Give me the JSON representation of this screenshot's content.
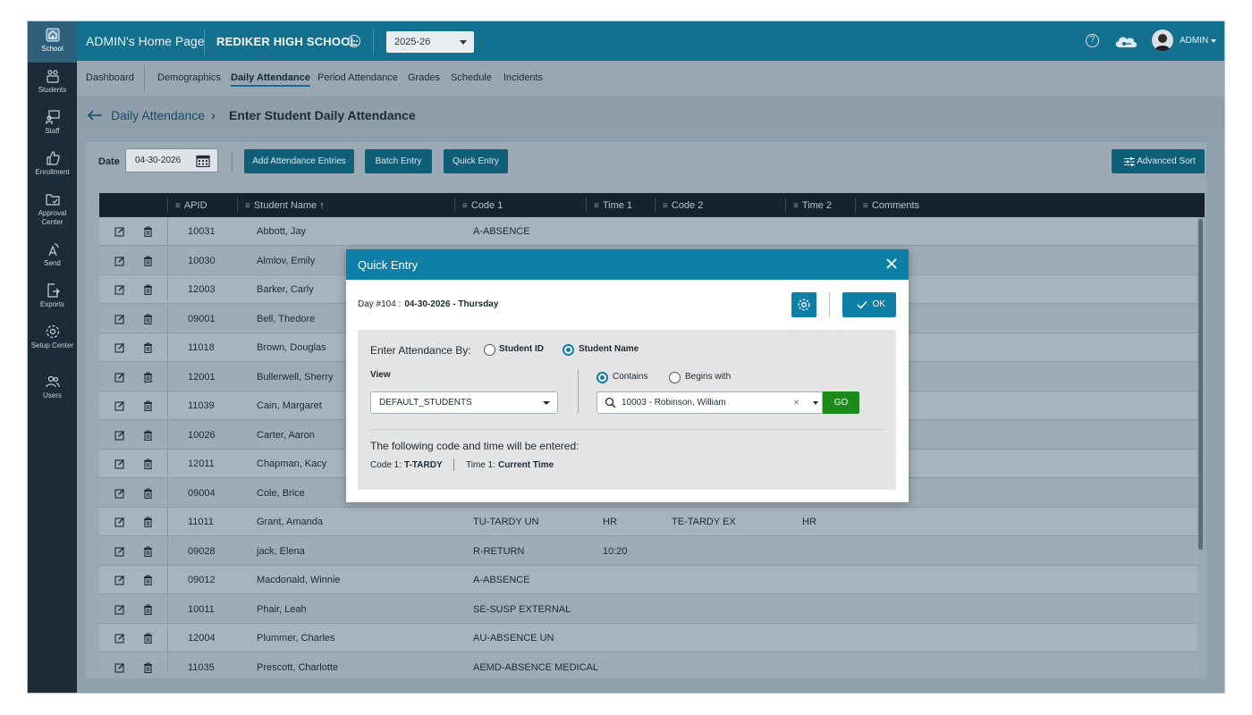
{
  "sidebar": {
    "items": [
      {
        "label": "School",
        "icon": "school-icon",
        "active": true
      },
      {
        "label": "Students",
        "icon": "students-icon"
      },
      {
        "label": "Staff",
        "icon": "staff-icon"
      },
      {
        "label": "Enrollment",
        "icon": "thumbs-up-icon"
      },
      {
        "label": "Approval Center",
        "icon": "folder-check-icon"
      },
      {
        "label": "Send",
        "icon": "send-icon"
      },
      {
        "label": "Exports",
        "icon": "export-icon"
      },
      {
        "label": "Setup Center",
        "icon": "gear-icon"
      },
      {
        "label": "Users",
        "icon": "users-icon"
      }
    ]
  },
  "header": {
    "home_title": "ADMIN's Home Page",
    "school": "REDIKER HIGH SCHOOL",
    "year": "2025-26",
    "user": "ADMIN"
  },
  "subnav": {
    "tabs": [
      "Dashboard",
      "Demographics",
      "Daily Attendance",
      "Period Attendance",
      "Grades",
      "Schedule",
      "Incidents"
    ],
    "active": "Daily Attendance"
  },
  "breadcrumb": {
    "parent": "Daily Attendance",
    "current": "Enter Student Daily Attendance"
  },
  "toolbar": {
    "date_label": "Date",
    "date_value": "04-30-2026",
    "add_entries": "Add Attendance Entries",
    "batch_entry": "Batch Entry",
    "quick_entry": "Quick Entry",
    "advanced_sort": "Advanced Sort"
  },
  "table": {
    "columns": [
      "APID",
      "Student Name ↑",
      "Code 1",
      "Time 1",
      "Code 2",
      "Time 2",
      "Comments"
    ],
    "rows": [
      {
        "apid": "10031",
        "name": "Abbott, Jay",
        "code1": "A-ABSENCE",
        "time1": "",
        "code2": "",
        "time2": ""
      },
      {
        "apid": "10030",
        "name": "Almlov, Emily",
        "code1": "",
        "time1": "",
        "code2": "",
        "time2": ""
      },
      {
        "apid": "12003",
        "name": "Barker, Carly",
        "code1": "",
        "time1": "",
        "code2": "",
        "time2": ""
      },
      {
        "apid": "09001",
        "name": "Bell, Thedore",
        "code1": "",
        "time1": "",
        "code2": "",
        "time2": ""
      },
      {
        "apid": "11018",
        "name": "Brown, Douglas",
        "code1": "",
        "time1": "",
        "code2": "",
        "time2": ""
      },
      {
        "apid": "12001",
        "name": "Bullerwell, Sherry",
        "code1": "",
        "time1": "",
        "code2": "",
        "time2": ""
      },
      {
        "apid": "11039",
        "name": "Cain, Margaret",
        "code1": "",
        "time1": "",
        "code2": "",
        "time2": ""
      },
      {
        "apid": "10026",
        "name": "Carter, Aaron",
        "code1": "",
        "time1": "",
        "code2": "",
        "time2": ""
      },
      {
        "apid": "12011",
        "name": "Chapman, Kacy",
        "code1": "",
        "time1": "",
        "code2": "",
        "time2": ""
      },
      {
        "apid": "09004",
        "name": "Cole, Brice",
        "code1": "",
        "time1": "",
        "code2": "",
        "time2": ""
      },
      {
        "apid": "11011",
        "name": "Grant, Amanda",
        "code1": "TU-TARDY UN",
        "time1": "HR",
        "code2": "TE-TARDY EX",
        "time2": "HR"
      },
      {
        "apid": "09028",
        "name": "jack, Elena",
        "code1": "R-RETURN",
        "time1": "10:20",
        "code2": "",
        "time2": ""
      },
      {
        "apid": "09012",
        "name": "Macdonald, Winnie",
        "code1": "A-ABSENCE",
        "time1": "",
        "code2": "",
        "time2": ""
      },
      {
        "apid": "10011",
        "name": "Phair, Leah",
        "code1": "SE-SUSP EXTERNAL",
        "time1": "",
        "code2": "",
        "time2": ""
      },
      {
        "apid": "12004",
        "name": "Plummer, Charles",
        "code1": "AU-ABSENCE UN",
        "time1": "",
        "code2": "",
        "time2": ""
      },
      {
        "apid": "11035",
        "name": "Prescott, Charlotte",
        "code1": "AEMD-ABSENCE MEDICAL",
        "time1": "",
        "code2": "",
        "time2": ""
      }
    ]
  },
  "modal": {
    "title": "Quick Entry",
    "day_label": "Day #104 :",
    "day_value": "04-30-2026 - Thursday",
    "ok_label": "OK",
    "enter_by_label": "Enter Attendance By:",
    "opt_student_id": "Student ID",
    "opt_student_name": "Student Name",
    "view_label": "View",
    "view_value": "DEFAULT_STUDENTS",
    "opt_contains": "Contains",
    "opt_begins": "Begins with",
    "search_value": "10003 - Robinson, William",
    "go_label": "GO",
    "following_text": "The following code and time will be entered:",
    "code_label": "Code 1:",
    "code_value": "T-TARDY",
    "time_label": "Time 1:",
    "time_value": "Current Time"
  }
}
